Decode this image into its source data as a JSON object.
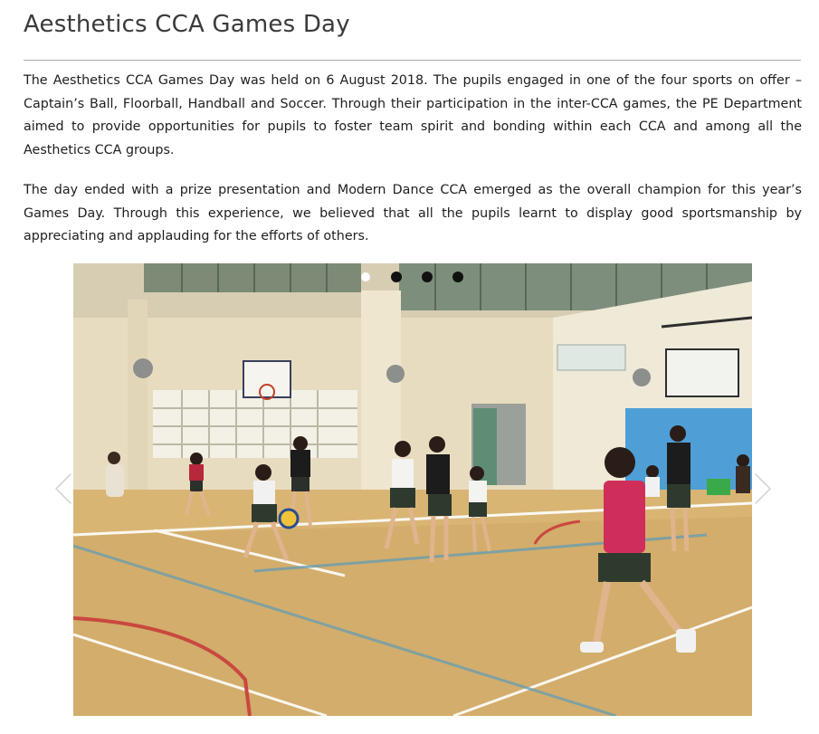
{
  "page": {
    "title": "Aesthetics CCA Games Day"
  },
  "article": {
    "paragraphs": [
      "The Aesthetics CCA Games Day was held on 6 August 2018. The pupils engaged in one of the four sports on offer – Captain’s Ball, Floorball, Handball and Soccer. Through their participation in the inter-CCA games, the PE Department aimed to provide opportunities for pupils to foster team spirit and bonding within each CCA and among all the Aesthetics CCA groups.",
      "The day ended with a prize presentation and Modern Dance CCA emerged as the overall champion for this year’s Games Day. Through this experience, we believed that all the pupils learnt to display good sportsmanship by appreciating and applauding for the efforts of others."
    ]
  },
  "carousel": {
    "slide_count": 4,
    "active_index": 0,
    "prev_icon": "chevron-left-icon",
    "next_icon": "chevron-right-icon",
    "photo": "indoor-sports-hall-children-playing-handball"
  },
  "colors": {
    "title": "#3a3a3a",
    "rule": "#a8a8a8",
    "dot_active": "#ffffff",
    "dot_inactive": "#111111"
  }
}
